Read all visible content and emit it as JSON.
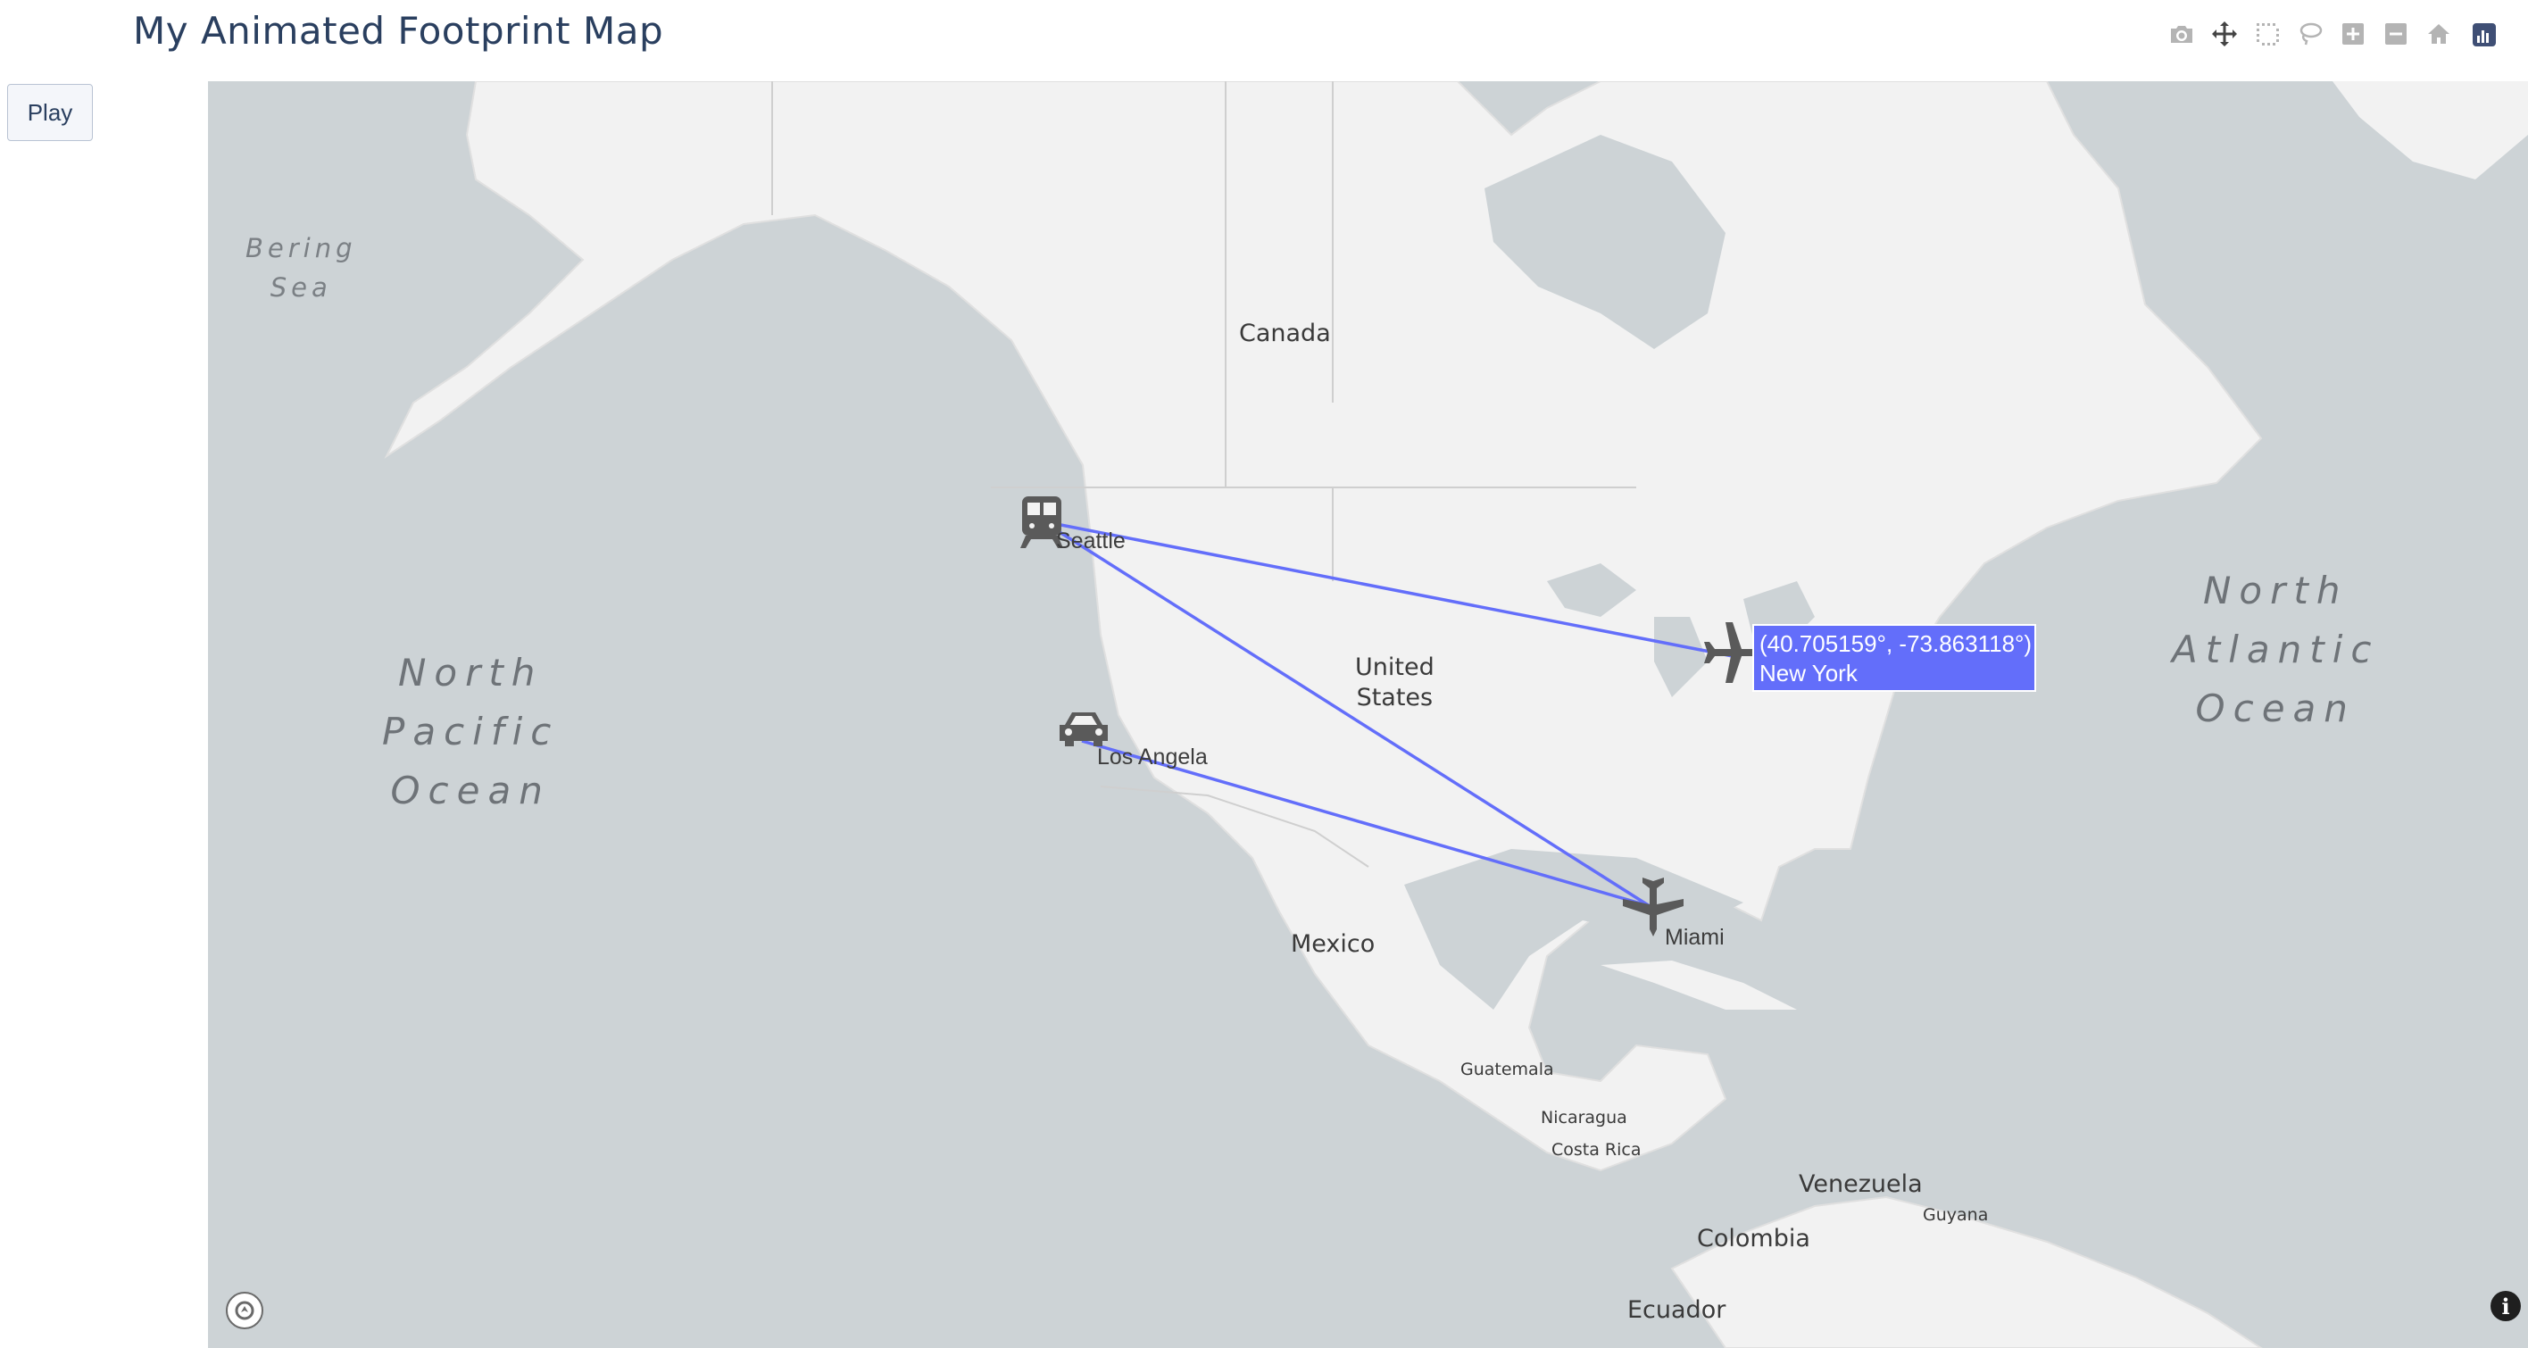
{
  "title": "My Animated Footprint Map",
  "play_label": "Play",
  "modebar": [
    {
      "name": "camera-icon"
    },
    {
      "name": "pan-icon"
    },
    {
      "name": "box-select-icon"
    },
    {
      "name": "lasso-select-icon"
    },
    {
      "name": "zoom-in-icon"
    },
    {
      "name": "zoom-out-icon"
    },
    {
      "name": "home-icon"
    },
    {
      "name": "plotly-logo-icon"
    }
  ],
  "map": {
    "oceans": {
      "north_pacific": [
        "North",
        "Pacific",
        "Ocean"
      ],
      "north_atlantic": [
        "North",
        "Atlantic",
        "Ocean"
      ],
      "bering_sea": [
        "Bering",
        "Sea"
      ]
    },
    "countries": {
      "canada": "Canada",
      "united_states": [
        "United",
        "States"
      ],
      "mexico": "Mexico",
      "guatemala": "Guatemala",
      "nicaragua": "Nicaragua",
      "costa_rica": "Costa Rica",
      "venezuela": "Venezuela",
      "guyana": "Guyana",
      "colombia": "Colombia",
      "ecuador": "Ecuador"
    },
    "route_color": "#636efa",
    "markers": [
      {
        "city": "Seattle",
        "icon": "train-icon"
      },
      {
        "city": "New York",
        "icon": "airplane-icon"
      },
      {
        "city": "Los Angela",
        "icon": "car-icon"
      },
      {
        "city": "Miami",
        "icon": "airplane-icon"
      }
    ],
    "tooltip": {
      "coords": "(40.705159°, -73.863118°)",
      "city": "New York"
    }
  }
}
